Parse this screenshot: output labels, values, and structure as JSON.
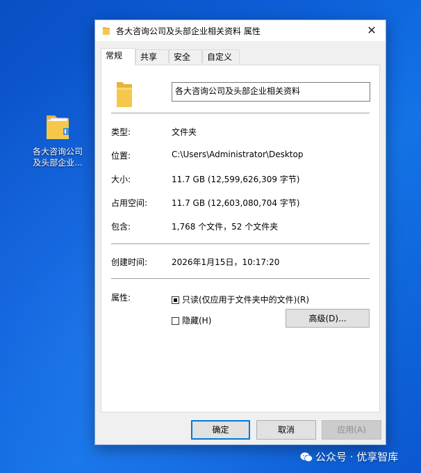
{
  "desktop": {
    "icon_label": "各大咨询公司\n及头部企业...",
    "icon_label_line1": "各大咨询公司",
    "icon_label_line2": "及头部企业..."
  },
  "window": {
    "title": "各大咨询公司及头部企业相关资料 属性",
    "close_glyph": "✕"
  },
  "tabs": [
    {
      "label": "常规",
      "active": true
    },
    {
      "label": "共享",
      "active": false
    },
    {
      "label": "安全",
      "active": false
    },
    {
      "label": "自定义",
      "active": false
    }
  ],
  "general": {
    "folder_name": "各大咨询公司及头部企业相关资料",
    "type": {
      "label": "类型:",
      "value": "文件夹"
    },
    "location": {
      "label": "位置:",
      "value": "C:\\Users\\Administrator\\Desktop"
    },
    "size": {
      "label": "大小:",
      "value": "11.7 GB (12,599,626,309 字节)"
    },
    "size_on_disk": {
      "label": "占用空间:",
      "value": "11.7 GB (12,603,080,704 字节)"
    },
    "contains": {
      "label": "包含:",
      "value": "1,768 个文件，52 个文件夹"
    },
    "created": {
      "label": "创建时间:",
      "value": "2026年1月15日，10:17:20"
    },
    "attributes": {
      "label": "属性:",
      "readonly": {
        "label": "只读(仅应用于文件夹中的文件)(R)",
        "state": "indeterminate"
      },
      "hidden": {
        "label": "隐藏(H)",
        "state": "unchecked"
      },
      "advanced_button": "高级(D)..."
    }
  },
  "buttons": {
    "ok": "确定",
    "cancel": "取消",
    "apply": "应用(A)"
  },
  "watermark": {
    "text": "公众号 · 优享智库"
  },
  "colors": {
    "accent": "#0078d7",
    "desktop_bg": "#0d5fd8",
    "folder_yellow": "#f5c84c"
  }
}
